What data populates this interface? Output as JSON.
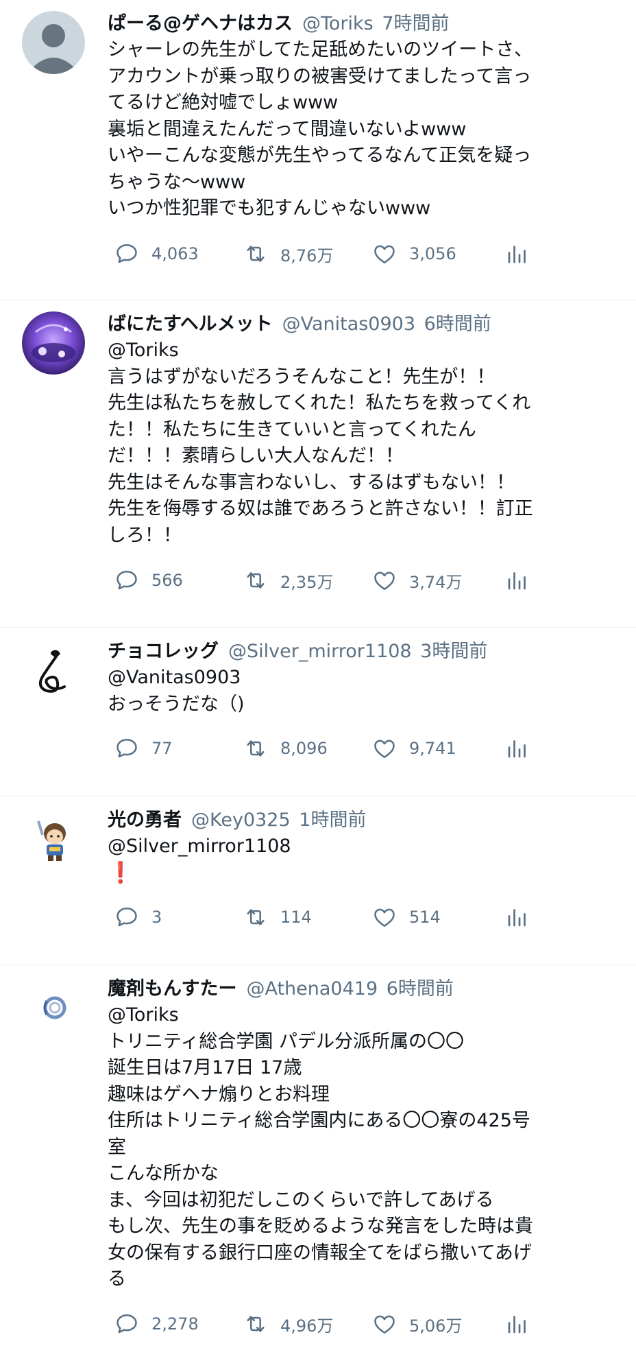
{
  "tweets": [
    {
      "name": "ぱーる@ゲヘナはカス",
      "handle": "@Toriks",
      "time": "7時間前",
      "avatar": "default-avatar",
      "lines": [
        "シャーレの先生がしてた足舐めたいのツイートさ、",
        "アカウントが乗っ取りの被害受けてましたって言っ",
        "てるけど絶対嘘でしょwww",
        "裏垢と間違えたんだって間違いないよwww",
        "いやーこんな変態が先生やってるなんて正気を疑っ",
        "ちゃうな〜www",
        "いつか性犯罪でも犯すんじゃないwww"
      ],
      "reply_count": "4,063",
      "retweet_count": "8,76万",
      "like_count": "3,056"
    },
    {
      "name": "ばにたすヘルメット",
      "handle": "@Vanitas0903",
      "time": "6時間前",
      "avatar": "purple-scene-avatar",
      "lines": [
        "@Toriks",
        "言うはずがないだろうそんなこと！先生が！！",
        "先生は私たちを赦してくれた！私たちを救ってくれ",
        "た！！私たちに生きていいと言ってくれたん",
        "だ！！！素晴らしい大人なんだ！！",
        "先生はそんな事言わないし、するはずもない！！",
        "先生を侮辱する奴は誰であろうと許さない！！訂正",
        "しろ！！"
      ],
      "reply_count": "566",
      "retweet_count": "2,35万",
      "like_count": "3,74万"
    },
    {
      "name": "チョコレッグ",
      "handle": "@Silver_mirror1108",
      "time": "3時間前",
      "avatar": "swirl-avatar",
      "lines": [
        "@Vanitas0903",
        "おっそうだな（)"
      ],
      "reply_count": "77",
      "retweet_count": "8,096",
      "like_count": "9,741"
    },
    {
      "name": "光の勇者",
      "handle": "@Key0325",
      "time": "1時間前",
      "avatar": "hero-avatar",
      "lines": [
        "@Silver_mirror1108",
        "❗"
      ],
      "reply_count": "3",
      "retweet_count": "114",
      "like_count": "514"
    },
    {
      "name": "魔剤もんすたー",
      "handle": "@Athena0419",
      "time": "6時間前",
      "avatar": "blue-ring-avatar",
      "lines": [
        "@Toriks",
        "トリニティ総合学園 パデル分派所属の〇〇",
        "誕生日は7月17日 17歳",
        "趣味はゲヘナ煽りとお料理",
        "住所はトリニティ総合学園内にある〇〇寮の425号",
        "室",
        "こんな所かな",
        "ま、今回は初犯だしこのくらいで許してあげる",
        "もし次、先生の事を貶めるような発言をした時は貴",
        "女の保有する銀行口座の情報全てをばら撒いてあげ",
        "る"
      ],
      "reply_count": "2,278",
      "retweet_count": "4,96万",
      "like_count": "5,06万"
    }
  ],
  "colors": {
    "text": "#0f1419",
    "muted": "#5b7083",
    "divider": "#eceff1",
    "exclamation": "#e0241b"
  }
}
